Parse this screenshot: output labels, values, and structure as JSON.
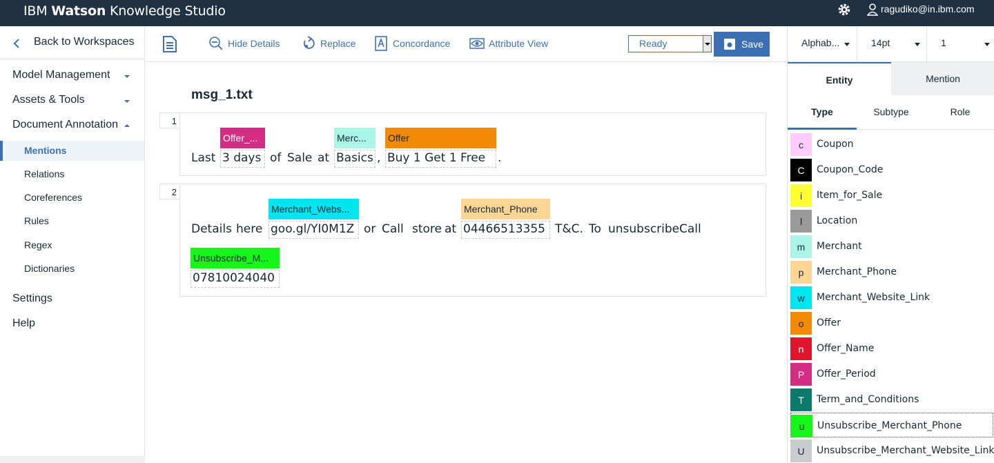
{
  "header": {
    "brand_prefix": "IBM ",
    "brand_bold": "Watson",
    "brand_suffix": " Knowledge Studio",
    "user_email": "ragudiko@in.ibm.com"
  },
  "nav": {
    "back_label": "Back to Workspaces",
    "sections": [
      {
        "label": "Model Management"
      },
      {
        "label": "Assets & Tools"
      },
      {
        "label": "Document Annotation"
      }
    ],
    "subitems": [
      {
        "label": "Mentions"
      },
      {
        "label": "Relations"
      },
      {
        "label": "Coreferences"
      },
      {
        "label": "Rules"
      },
      {
        "label": "Regex"
      },
      {
        "label": "Dictionaries"
      }
    ],
    "settings": "Settings",
    "help": "Help"
  },
  "toolbar": {
    "hide_details": "Hide Details",
    "replace": "Replace",
    "concordance": "Concordance",
    "attribute_view": "Attribute View",
    "status": "Ready",
    "save": "Save"
  },
  "document": {
    "title": "msg_1.txt",
    "sentence1": {
      "number": "1",
      "tokens": [
        "Last",
        "3 days",
        "of",
        "Sale",
        "at",
        "Basics",
        ",",
        "Buy 1 Get 1 Free",
        "."
      ],
      "tags": [
        "Offer_...",
        "Merc...",
        "Offer"
      ]
    },
    "sentence2": {
      "number": "2",
      "tokens": [
        "Details",
        "here",
        "goo.gl/YI0M1Z",
        "or",
        "Call",
        "store",
        "at",
        "04466513355",
        "T&C.",
        "To",
        "unsubscribe",
        "Call",
        "07810024040"
      ],
      "tags": [
        "Merchant_Webs...",
        "Merchant_Phone",
        "Unsubscribe_M..."
      ]
    }
  },
  "panel": {
    "sort": "Alphab...",
    "font_size": "14pt",
    "page": "1",
    "tabs": [
      "Entity",
      "Mention"
    ],
    "subtabs": [
      "Type",
      "Subtype",
      "Role"
    ],
    "entities": [
      {
        "key": "c",
        "name": "Coupon",
        "color": "#ffccff",
        "fg": "#152935"
      },
      {
        "key": "C",
        "name": "Coupon_Code",
        "color": "#000000",
        "fg": "#ffffff"
      },
      {
        "key": "i",
        "name": "Item_for_Sale",
        "color": "#ffff33",
        "fg": "#152935"
      },
      {
        "key": "l",
        "name": "Location",
        "color": "#9a9a9a",
        "fg": "#152935"
      },
      {
        "key": "m",
        "name": "Merchant",
        "color": "#aaf5e6",
        "fg": "#152935"
      },
      {
        "key": "p",
        "name": "Merchant_Phone",
        "color": "#fdd695",
        "fg": "#152935"
      },
      {
        "key": "w",
        "name": "Merchant_Website_Link",
        "color": "#00e6f0",
        "fg": "#152935"
      },
      {
        "key": "o",
        "name": "Offer",
        "color": "#f28a05",
        "fg": "#152935"
      },
      {
        "key": "n",
        "name": "Offer_Name",
        "color": "#e0172c",
        "fg": "#ffffff"
      },
      {
        "key": "P",
        "name": "Offer_Period",
        "color": "#d42d84",
        "fg": "#ffffff"
      },
      {
        "key": "T",
        "name": "Term_and_Conditions",
        "color": "#0a7a6a",
        "fg": "#ffffff"
      },
      {
        "key": "u",
        "name": "Unsubscribe_Merchant_Phone",
        "color": "#17f51b",
        "fg": "#152935"
      },
      {
        "key": "U",
        "name": "Unsubscribe_Merchant_Website_Link",
        "color": "#c8cccf",
        "fg": "#152935"
      }
    ]
  }
}
